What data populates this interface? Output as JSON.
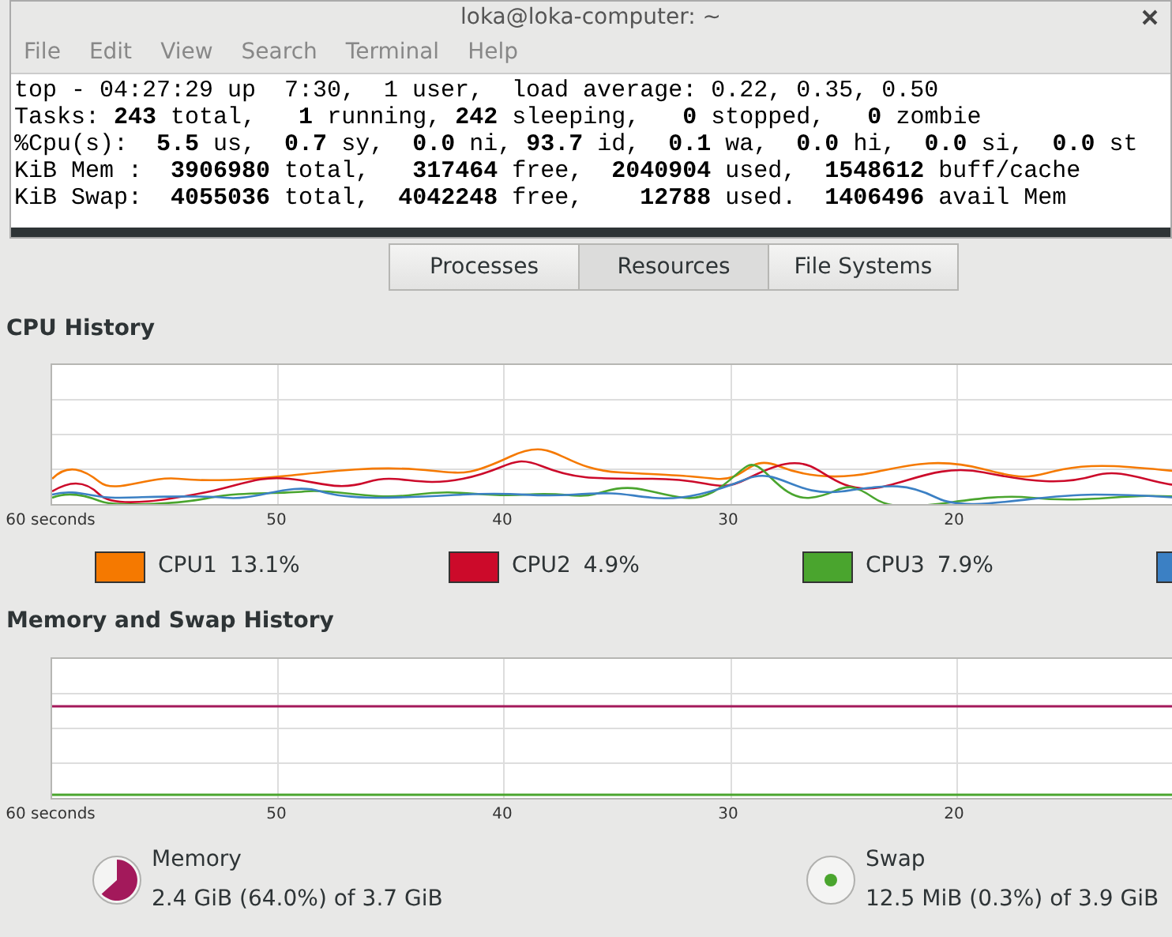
{
  "terminal": {
    "title": "loka@loka-computer: ~",
    "menu": [
      "File",
      "Edit",
      "View",
      "Search",
      "Terminal",
      "Help"
    ],
    "lines": [
      "top - 04:27:29 up  7:30,  1 user,  load average: 0.22, 0.35, 0.50",
      "Tasks: **243** total,   **1** running, **242** sleeping,   **0** stopped,   **0** zombie",
      "%Cpu(s):  **5.5** us,  **0.7** sy,  **0.0** ni, **93.7** id,  **0.1** wa,  **0.0** hi,  **0.0** si,  **0.0** st",
      "KiB Mem :  **3906980** total,   **317464** free,  **2040904** used,  **1548612** buff/cache",
      "KiB Swap:  **4055036** total,  **4042248** free,    **12788** used.  **1406496** avail Mem"
    ]
  },
  "tabs": [
    {
      "label": "Processes",
      "selected": false
    },
    {
      "label": "Resources",
      "selected": true
    },
    {
      "label": "File Systems",
      "selected": false
    }
  ],
  "cpu": {
    "title": "CPU History",
    "x_labels": [
      "60 seconds",
      "50",
      "40",
      "30",
      "20"
    ],
    "legend": [
      {
        "label": "CPU1",
        "value": "13.1%",
        "color": "#f57900"
      },
      {
        "label": "CPU2",
        "value": "4.9%",
        "color": "#cc0a2a"
      },
      {
        "label": "CPU3",
        "value": "7.9%",
        "color": "#4aa52e"
      },
      {
        "color": "#3b80c4"
      }
    ]
  },
  "memory": {
    "title": "Memory and Swap History",
    "x_labels": [
      "60 seconds",
      "50",
      "40",
      "30",
      "20"
    ],
    "items": [
      {
        "label": "Memory",
        "value": "2.4 GiB (64.0%) of 3.7 GiB",
        "color": "#a3195b",
        "kind": "pie"
      },
      {
        "label": "Swap",
        "value": "12.5 MiB (0.3%) of 3.9 GiB",
        "color": "#4aa52e",
        "kind": "dot"
      }
    ]
  }
}
